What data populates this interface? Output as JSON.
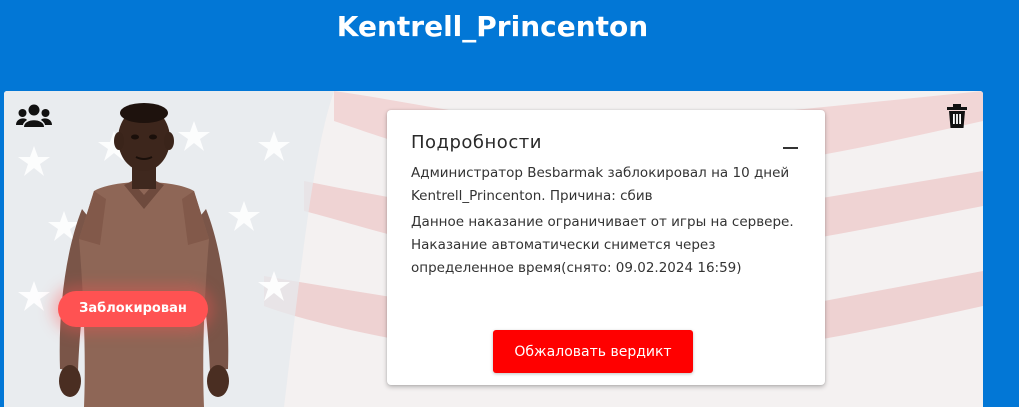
{
  "header": {
    "title": "Kentrell_Princenton"
  },
  "profile": {
    "status_badge": "Заблокирован",
    "group_icon": "users-group-icon",
    "delete_icon": "trash-icon"
  },
  "details": {
    "title": "Подробности",
    "collapse_icon": "minus-icon",
    "description": "Администратор Besbarmak заблокировал на 10 дней Kentrell_Princenton. Причина: сбив",
    "note": "Данное наказание ограничивает от игры на сервере. Наказание автоматически снимется через определенное время(снято: 09.02.2024 16:59)",
    "appeal_button": "Обжаловать вердикт"
  },
  "colors": {
    "header_bg": "#0277d6",
    "badge_bg": "#ff5252",
    "appeal_button_bg": "#ff0000"
  }
}
